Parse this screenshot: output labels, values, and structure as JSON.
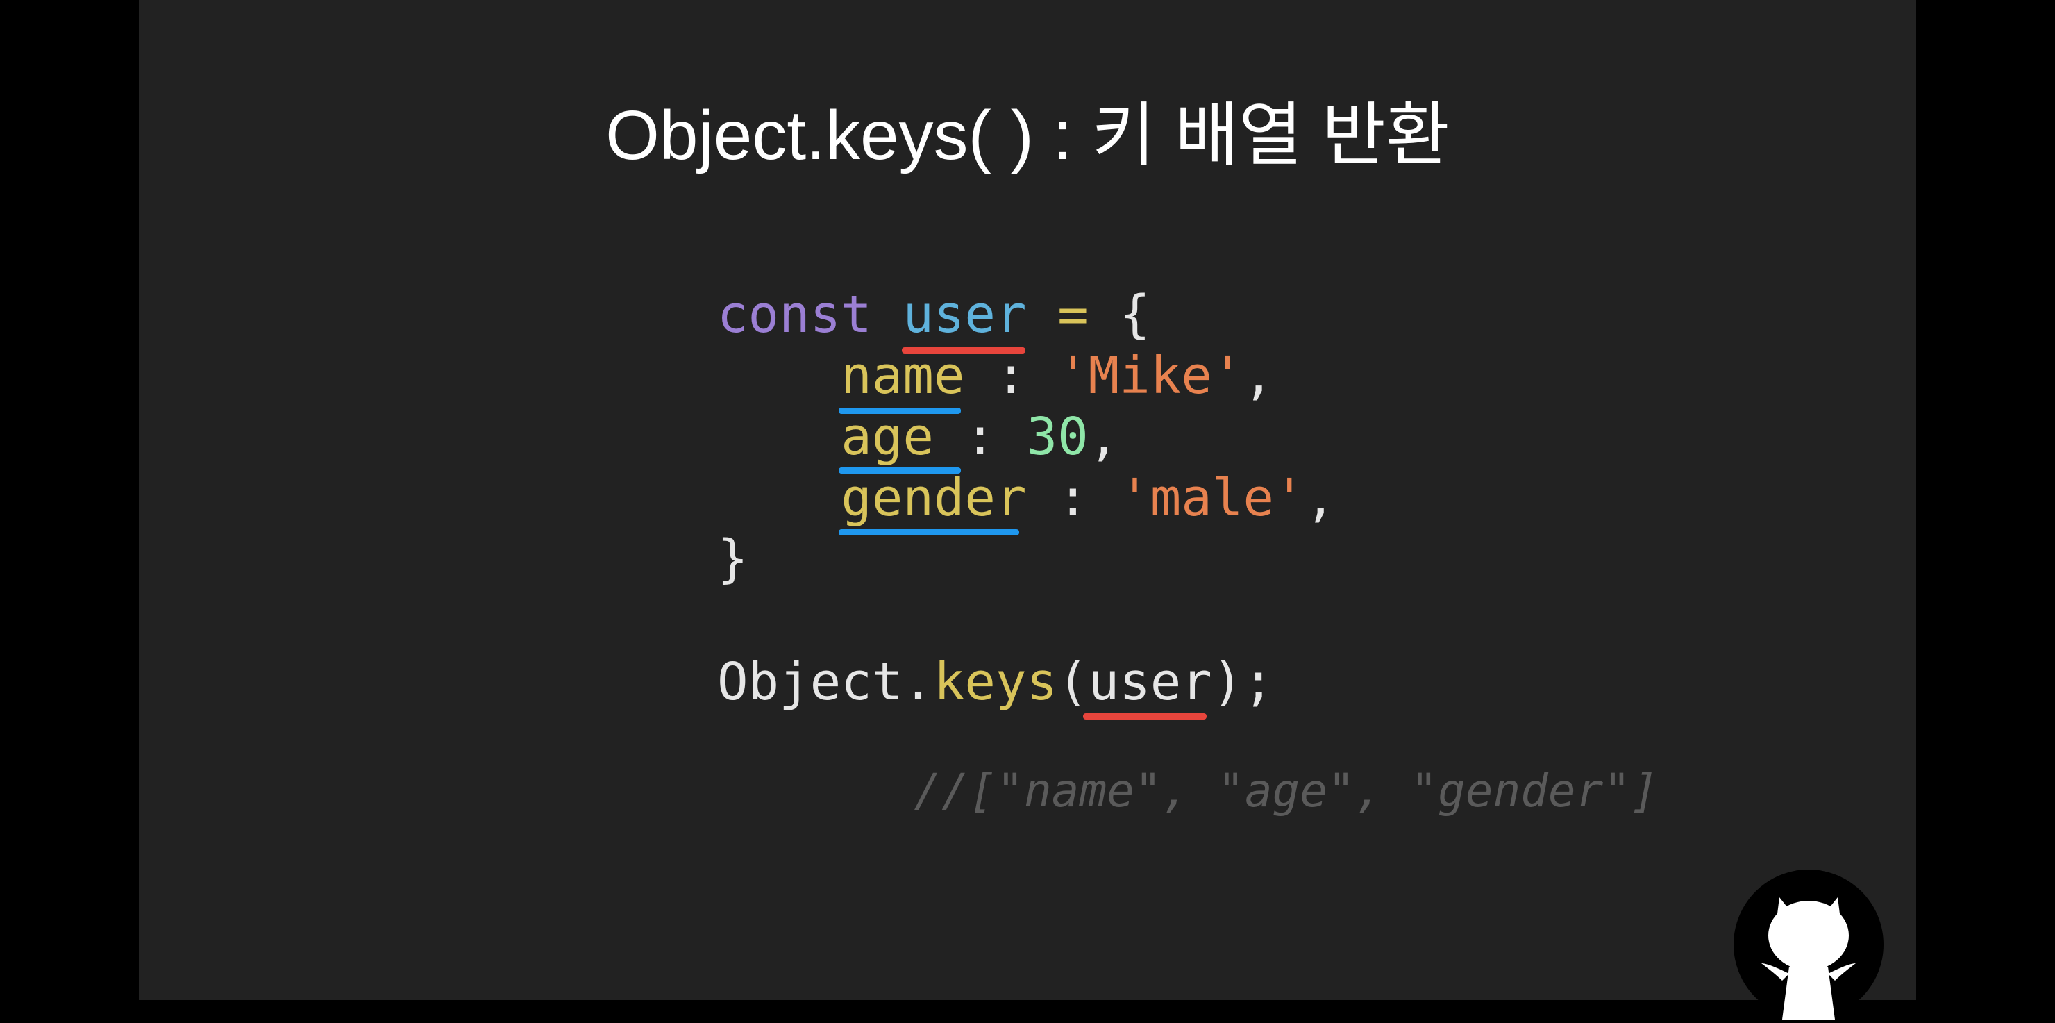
{
  "title": "Object.keys( ) : 키 배열 반환",
  "code": {
    "line1": {
      "kw": "const ",
      "var": "user",
      "op": " = ",
      "brace": "{"
    },
    "line2": {
      "key": "name",
      "sep": " : ",
      "val": "'Mike'",
      "comma": ","
    },
    "line3": {
      "key": "age",
      "sep": " : ",
      "val": "30",
      "comma": ","
    },
    "line4": {
      "key": "gender",
      "sep": " : ",
      "val": "'male'",
      "comma": ","
    },
    "line5": "}",
    "call": {
      "obj": "Object.",
      "fn": "keys",
      "open": "(",
      "arg": "user",
      "close": ");"
    },
    "comment": "//[\"name\", \"age\", \"gender\"]"
  },
  "colors": {
    "keyword": "#9b7fd4",
    "variable": "#5fb2dc",
    "key": "#d9c45a",
    "string": "#e8824f",
    "number": "#8fe6a8",
    "underline_red": "#e8453c",
    "underline_blue": "#1f98ef"
  },
  "logo_icon": "devil-cat-logo-icon"
}
